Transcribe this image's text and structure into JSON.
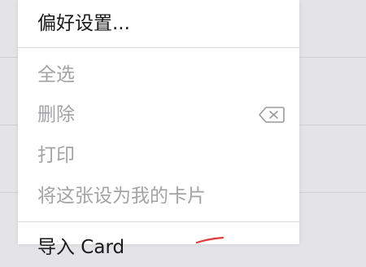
{
  "menu": {
    "items": [
      {
        "label": "偏好设置...",
        "enabled": true
      },
      {
        "label": "全选",
        "enabled": false
      },
      {
        "label": "删除",
        "enabled": false,
        "icon": "delete-backspace-icon"
      },
      {
        "label": "打印",
        "enabled": false
      },
      {
        "label": "将这张设为我的卡片",
        "enabled": false
      },
      {
        "label": "导入 Card",
        "enabled": true,
        "partially_visible": true
      }
    ]
  },
  "colors": {
    "enabled_text": "#1a1a1a",
    "disabled_text": "#a3a3a6",
    "menu_background": "#ffffff",
    "page_background": "#e4e4e7",
    "annotation": "#e23b3b"
  }
}
